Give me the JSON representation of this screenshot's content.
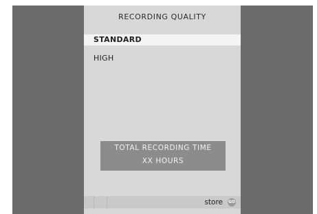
{
  "menu": {
    "title": "RECORDING QUALITY",
    "items": [
      {
        "label": "STANDARD",
        "selected": true
      },
      {
        "label": "HIGH",
        "selected": false
      }
    ]
  },
  "info": {
    "line1": "TOTAL RECORDING TIME",
    "line2": "XX HOURS"
  },
  "footer": {
    "store_label": "store",
    "go_label": "GO"
  },
  "colors": {
    "background": "#6b6b6b",
    "panel": "#d8d8d8",
    "selected_row": "#f4f4f4",
    "info_box": "#8c8c8c"
  }
}
